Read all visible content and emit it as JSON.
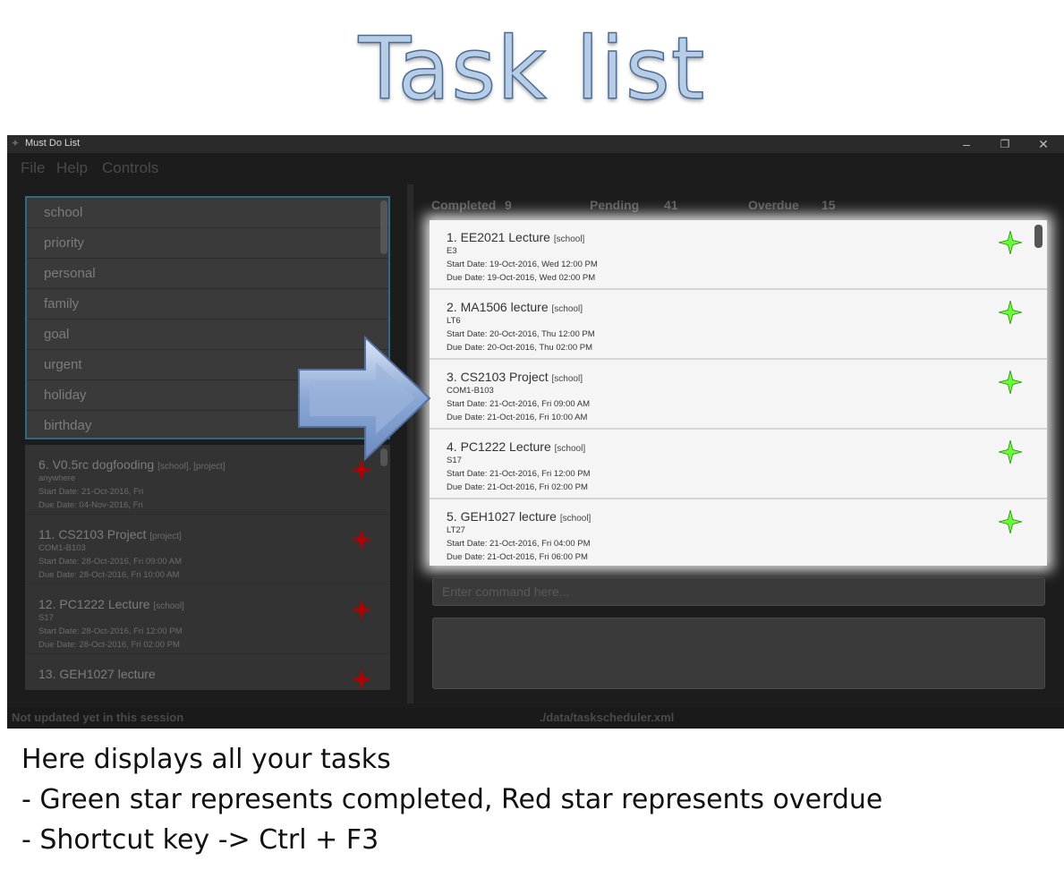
{
  "slide": {
    "title": "Task list",
    "caption": [
      "Here displays all your tasks",
      "- Green star represents completed, Red star represents overdue",
      "- Shortcut key -> Ctrl + F3"
    ]
  },
  "window": {
    "title": "Must Do List",
    "minimize": "–",
    "restore": "❐",
    "close": "✕"
  },
  "menu": [
    "File",
    "Help",
    "Controls"
  ],
  "tags": [
    "school",
    "priority",
    "personal",
    "family",
    "goal",
    "urgent",
    "holiday",
    "birthday"
  ],
  "overdue_tasks": [
    {
      "title": "6. V0.5rc dogfooding",
      "tags": "[school], [project]",
      "location": "anywhere",
      "start": "Start Date: 21-Oct-2016, Fri",
      "due": "Due Date: 04-Nov-2016, Fri"
    },
    {
      "title": "11. CS2103 Project",
      "tags": "[project]",
      "location": "COM1-B103",
      "start": "Start Date: 28-Oct-2016, Fri 09:00 AM",
      "due": "Due Date: 28-Oct-2016, Fri 10:00 AM"
    },
    {
      "title": "12. PC1222 Lecture",
      "tags": "[school]",
      "location": "S17",
      "start": "Start Date: 28-Oct-2016, Fri 12:00 PM",
      "due": "Due Date: 28-Oct-2016, Fri 02:00 PM"
    },
    {
      "title": "13. GEH1027 lecture",
      "tags": "",
      "location": "",
      "start": "",
      "due": ""
    }
  ],
  "stats": {
    "completed_label": "Completed",
    "completed_value": "9",
    "pending_label": "Pending",
    "pending_value": "41",
    "overdue_label": "Overdue",
    "overdue_value": "15"
  },
  "tasks": [
    {
      "title": "1. EE2021 Lecture",
      "tags": "[school]",
      "location": "E3",
      "start": "Start Date: 19-Oct-2016, Wed 12:00 PM",
      "due": "Due Date: 19-Oct-2016, Wed 02:00 PM"
    },
    {
      "title": "2. MA1506 lecture",
      "tags": "[school]",
      "location": "LT6",
      "start": "Start Date: 20-Oct-2016, Thu 12:00 PM",
      "due": "Due Date: 20-Oct-2016, Thu 02:00 PM"
    },
    {
      "title": "3. CS2103 Project",
      "tags": "[school]",
      "location": "COM1-B103",
      "start": "Start Date: 21-Oct-2016, Fri 09:00 AM",
      "due": "Due Date: 21-Oct-2016, Fri 10:00 AM"
    },
    {
      "title": "4. PC1222 Lecture",
      "tags": "[school]",
      "location": "S17",
      "start": "Start Date: 21-Oct-2016, Fri 12:00 PM",
      "due": "Due Date: 21-Oct-2016, Fri 02:00 PM"
    },
    {
      "title": "5. GEH1027 lecture",
      "tags": "[school]",
      "location": "LT27",
      "start": "Start Date: 21-Oct-2016, Fri 04:00 PM",
      "due": "Due Date: 21-Oct-2016, Fri 06:00 PM"
    }
  ],
  "command": {
    "placeholder": "Enter command here..."
  },
  "status": {
    "left": "Not updated yet in this session",
    "file": "./data/taskscheduler.xml"
  },
  "colors": {
    "completed_star": "#66ff33",
    "overdue_star": "#b30000",
    "accent_border": "#2e6a86"
  }
}
